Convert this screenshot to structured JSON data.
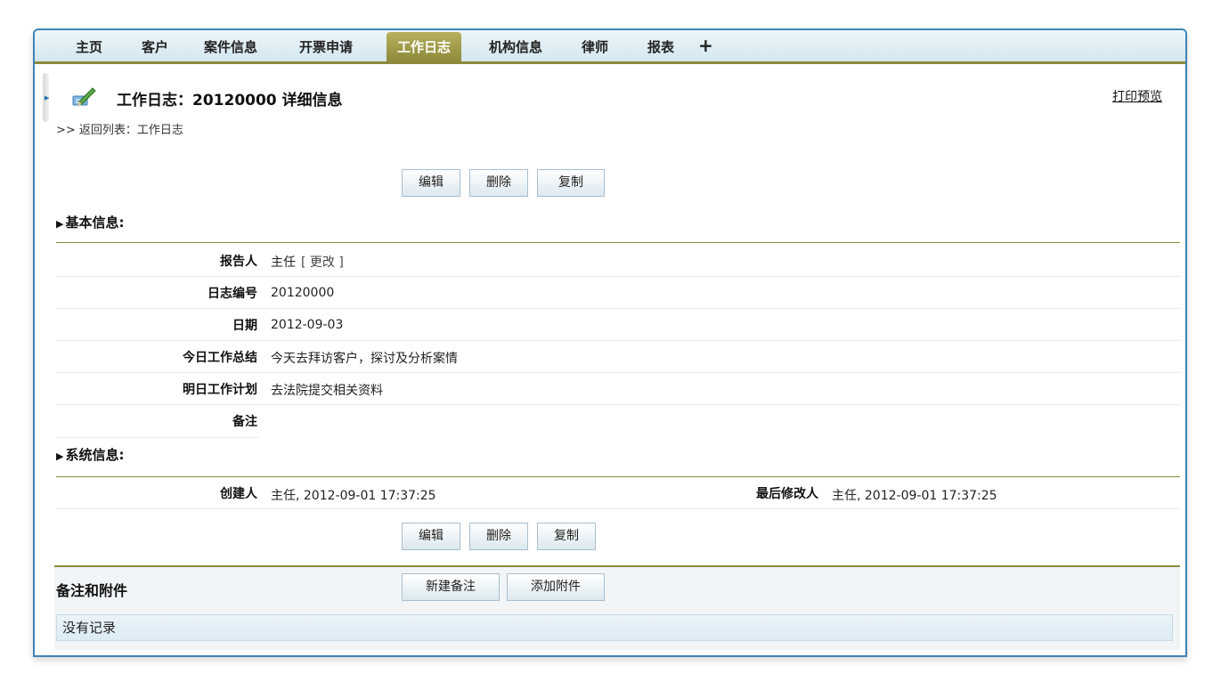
{
  "tabs": [
    {
      "label": "主页"
    },
    {
      "label": "客户"
    },
    {
      "label": "案件信息"
    },
    {
      "label": "开票申请"
    },
    {
      "label": "工作日志"
    },
    {
      "label": "机构信息"
    },
    {
      "label": "律师"
    },
    {
      "label": "报表"
    },
    {
      "label": "+"
    }
  ],
  "active_tab": "工作日志",
  "header": {
    "title": "工作日志：20120000 详细信息",
    "print_link": "打印预览",
    "breadcrumb": ">> 返回列表：工作日志"
  },
  "actions": {
    "edit": "编辑",
    "delete": "删除",
    "copy": "复制"
  },
  "basic_info": {
    "heading": "基本信息:",
    "reporter_label": "报告人",
    "reporter_value": "主任",
    "reporter_change": "[ 更改 ]",
    "log_no_label": "日志编号",
    "log_no_value": "20120000",
    "date_label": "日期",
    "date_value": "2012-09-03",
    "today_label": "今日工作总结",
    "today_value": "今天去拜访客户，探讨及分析案情",
    "tomorrow_label": "明日工作计划",
    "tomorrow_value": "去法院提交相关资料",
    "remark_label": "备注",
    "remark_value": ""
  },
  "system_info": {
    "heading": "系统信息:",
    "creator_label": "创建人",
    "creator_value": "主任, 2012-09-01 17:37:25",
    "modifier_label": "最后修改人",
    "modifier_value": "主任, 2012-09-01 17:37:25"
  },
  "notes": {
    "title": "备注和附件",
    "new_note": "新建备注",
    "add_attachment": "添加附件",
    "empty_text": "没有记录"
  },
  "colors": {
    "frame_border": "#3f83b4",
    "accent_olive": "#8b8a3c",
    "tab_active": "#a29e4a"
  }
}
